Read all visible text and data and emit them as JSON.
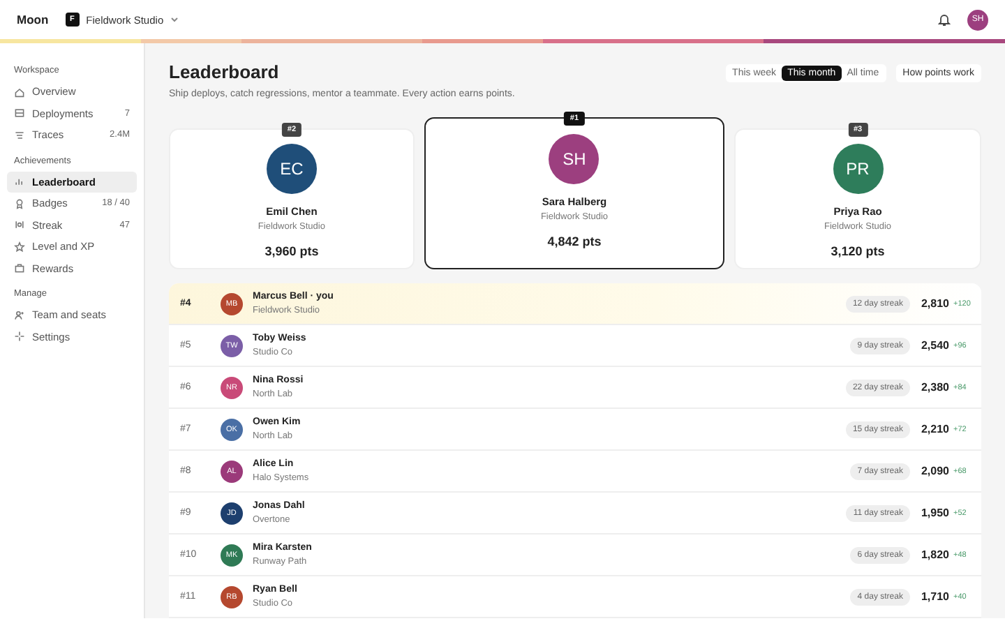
{
  "top_bar": {
    "app_name": "Moon",
    "workspace": {
      "initial": "F",
      "name": "Fieldwork Studio"
    },
    "user": {
      "initials": "SH",
      "color": "#9c3f7f"
    }
  },
  "sidebar": {
    "sections": [
      {
        "title": "Workspace",
        "items": [
          {
            "label": "Overview",
            "selected": false
          },
          {
            "label": "Deployments",
            "count": "7",
            "selected": false
          },
          {
            "label": "Traces",
            "count": "2.4M",
            "selected": false
          }
        ]
      },
      {
        "title": "Achievements",
        "items": [
          {
            "label": "Leaderboard",
            "selected": true
          },
          {
            "label": "Badges",
            "count": "18 / 40",
            "selected": false
          },
          {
            "label": "Streak",
            "count": "47",
            "selected": false
          },
          {
            "label": "Level and XP",
            "selected": false
          },
          {
            "label": "Rewards",
            "selected": false
          }
        ]
      },
      {
        "title": "Manage",
        "items": [
          {
            "label": "Team and seats",
            "selected": false
          },
          {
            "label": "Settings",
            "selected": false
          }
        ]
      }
    ]
  },
  "header": {
    "title": "Leaderboard",
    "subtitle": "Ship deploys, catch regressions, mentor a teammate. Every action earns points.",
    "period_tabs": [
      {
        "label": "This week",
        "selected": false
      },
      {
        "label": "This month",
        "selected": true
      },
      {
        "label": "All time",
        "selected": false
      }
    ],
    "help_button": "How points work"
  },
  "podium": [
    {
      "rank": "#2",
      "initials": "EC",
      "color": "#1f4e79",
      "name": "Emil Chen",
      "org": "Fieldwork Studio",
      "points": "3,960 pts",
      "featured": false
    },
    {
      "rank": "#1",
      "initials": "SH",
      "color": "#9c3f7f",
      "name": "Sara Halberg",
      "org": "Fieldwork Studio",
      "points": "4,842 pts",
      "featured": true
    },
    {
      "rank": "#3",
      "initials": "PR",
      "color": "#2e7d5b",
      "name": "Priya Rao",
      "org": "Fieldwork Studio",
      "points": "3,120 pts",
      "featured": false
    }
  ],
  "rows": [
    {
      "rank": "#4",
      "initials": "MB",
      "color": "#b5482f",
      "name": "Marcus Bell · you",
      "org": "Fieldwork Studio",
      "streak": "12 day streak",
      "points": "2,810",
      "delta": "+120",
      "current": true
    },
    {
      "rank": "#5",
      "initials": "TW",
      "color": "#7b5ea7",
      "name": "Toby Weiss",
      "org": "Studio Co",
      "streak": "9 day streak",
      "points": "2,540",
      "delta": "+96",
      "current": false
    },
    {
      "rank": "#6",
      "initials": "NR",
      "color": "#c94a78",
      "name": "Nina Rossi",
      "org": "North Lab",
      "streak": "22 day streak",
      "points": "2,380",
      "delta": "+84",
      "current": false
    },
    {
      "rank": "#7",
      "initials": "OK",
      "color": "#4a6fa5",
      "name": "Owen Kim",
      "org": "North Lab",
      "streak": "15 day streak",
      "points": "2,210",
      "delta": "+72",
      "current": false
    },
    {
      "rank": "#8",
      "initials": "AL",
      "color": "#9b3a7a",
      "name": "Alice Lin",
      "org": "Halo Systems",
      "streak": "7 day streak",
      "points": "2,090",
      "delta": "+68",
      "current": false
    },
    {
      "rank": "#9",
      "initials": "JD",
      "color": "#1d3f6e",
      "name": "Jonas Dahl",
      "org": "Overtone",
      "streak": "11 day streak",
      "points": "1,950",
      "delta": "+52",
      "current": false
    },
    {
      "rank": "#10",
      "initials": "MK",
      "color": "#2f7a55",
      "name": "Mira Karsten",
      "org": "Runway Path",
      "streak": "6 day streak",
      "points": "1,820",
      "delta": "+48",
      "current": false
    },
    {
      "rank": "#11",
      "initials": "RB",
      "color": "#b5482f",
      "name": "Ryan Bell",
      "org": "Studio Co",
      "streak": "4 day streak",
      "points": "1,710",
      "delta": "+40",
      "current": false
    }
  ]
}
